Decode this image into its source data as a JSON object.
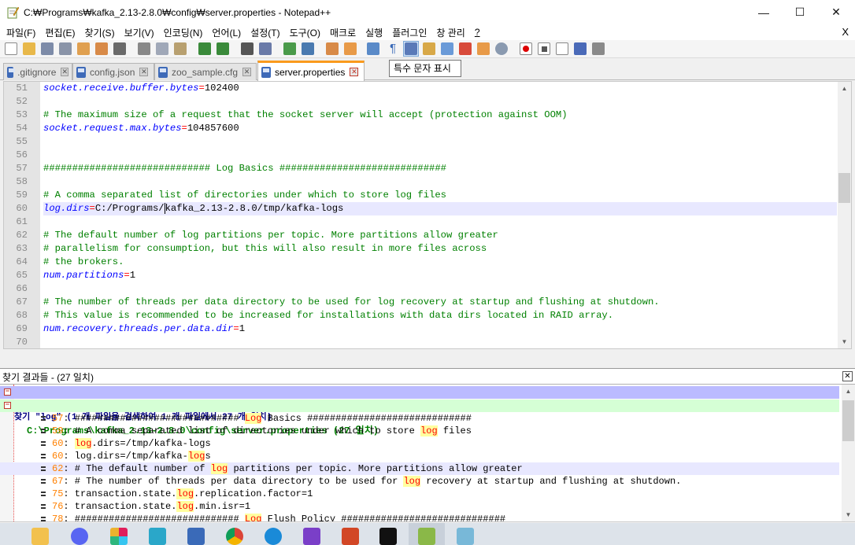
{
  "window": {
    "title": "C:₩Programs₩kafka_2.13-2.8.0₩config₩server.properties - Notepad++",
    "minimize_glyph": "—",
    "maximize_glyph": "☐",
    "close_glyph": "✕"
  },
  "menu": {
    "items": [
      "파일(F)",
      "편집(E)",
      "찾기(S)",
      "보기(V)",
      "인코딩(N)",
      "언어(L)",
      "설정(T)",
      "도구(O)",
      "매크로",
      "실행",
      "플러그인",
      "창 관리",
      "?"
    ],
    "close_label": "X"
  },
  "toolbar": {
    "icons": [
      "new-file-icon",
      "open-icon",
      "save-icon",
      "save-all-icon",
      "close-icon",
      "close-all-icon",
      "print-icon",
      "cut-icon",
      "copy-icon",
      "paste-icon",
      "undo-icon",
      "redo-icon",
      "find-icon",
      "replace-icon",
      "zoom-in-icon",
      "zoom-out-icon",
      "sync-v-icon",
      "sync-h-icon",
      "word-wrap-icon",
      "show-all-chars-icon",
      "indent-guide-icon",
      "doc-map-icon",
      "function-list-icon",
      "folder-workspace-icon",
      "monitor-icon",
      "record-macro-icon",
      "stop-macro-icon",
      "play-macro-icon",
      "run-macro-multiple-icon",
      "save-macro-icon"
    ],
    "tooltip": "특수 문자 표시"
  },
  "tabs": [
    {
      "label": ".gitignore",
      "active": false
    },
    {
      "label": "config.json",
      "active": false
    },
    {
      "label": "zoo_sample.cfg",
      "active": false
    },
    {
      "label": "server.properties",
      "active": true
    }
  ],
  "editor": {
    "lines": [
      {
        "n": "51",
        "type": "kv",
        "key": "socket.receive.buffer.bytes",
        "value": "102400"
      },
      {
        "n": "52",
        "type": "blank"
      },
      {
        "n": "53",
        "type": "comment",
        "text": "# The maximum size of a request that the socket server will accept (protection against OOM)"
      },
      {
        "n": "54",
        "type": "kv",
        "key": "socket.request.max.bytes",
        "value": "104857600"
      },
      {
        "n": "55",
        "type": "blank"
      },
      {
        "n": "56",
        "type": "blank"
      },
      {
        "n": "57",
        "type": "comment",
        "text": "############################# Log Basics #############################"
      },
      {
        "n": "58",
        "type": "blank"
      },
      {
        "n": "59",
        "type": "comment",
        "text": "# A comma separated list of directories under which to store log files"
      },
      {
        "n": "60",
        "type": "kv-caret",
        "key": "log.dirs",
        "value_before": "C:/Programs/",
        "value_after": "kafka_2.13-2.8.0/tmp/kafka-logs"
      },
      {
        "n": "61",
        "type": "blank"
      },
      {
        "n": "62",
        "type": "comment",
        "text": "# The default number of log partitions per topic. More partitions allow greater"
      },
      {
        "n": "63",
        "type": "comment",
        "text": "# parallelism for consumption, but this will also result in more files across"
      },
      {
        "n": "64",
        "type": "comment",
        "text": "# the brokers."
      },
      {
        "n": "65",
        "type": "kv",
        "key": "num.partitions",
        "value": "1"
      },
      {
        "n": "66",
        "type": "blank"
      },
      {
        "n": "67",
        "type": "comment",
        "text": "# The number of threads per data directory to be used for log recovery at startup and flushing at shutdown."
      },
      {
        "n": "68",
        "type": "comment",
        "text": "# This value is recommended to be increased for installations with data dirs located in RAID array."
      },
      {
        "n": "69",
        "type": "kv",
        "key": "num.recovery.threads.per.data.dir",
        "value": "1"
      },
      {
        "n": "70",
        "type": "blank"
      }
    ]
  },
  "find_results": {
    "title": "찾기 결과들 - (27 일치)",
    "close_glyph": "✕",
    "search_line": "찾기 \"log\" (1 개 파일을 검색하여 1 개 파일에서 27 개 일치)",
    "file_line": "C:\\Programs\\kafka_2.13-2.8.0\\config\\server.properties (27 일치)",
    "results": [
      {
        "num": "57",
        "before": "############################# ",
        "match": "Log",
        "after": " Basics #############################"
      },
      {
        "num": "59",
        "before": "# A comma separated list of directories under which to store ",
        "match": "log",
        "after": " files"
      },
      {
        "num": "60",
        "before": "",
        "match": "log",
        "after": ".dirs=/tmp/kafka-logs"
      },
      {
        "num": "60",
        "before": "log.dirs=/tmp/kafka-",
        "match": "log",
        "after": "s"
      },
      {
        "num": "62",
        "before": "# The default number of ",
        "match": "log",
        "after": " partitions per topic. More partitions allow greater"
      },
      {
        "num": "67",
        "before": "# The number of threads per data directory to be used for ",
        "match": "log",
        "after": " recovery at startup and flushing at shutdown."
      },
      {
        "num": "75",
        "before": "transaction.state.",
        "match": "log",
        "after": ".replication.factor=1"
      },
      {
        "num": "76",
        "before": "transaction.state.",
        "match": "log",
        "after": ".min.isr=1"
      },
      {
        "num": "78",
        "before": "############################# ",
        "match": "Log",
        "after": " Flush Policy #############################"
      }
    ]
  },
  "taskbar": {
    "apps": [
      "file-explorer-icon",
      "discord-icon",
      "slack-icon",
      "app-icon",
      "remote-desktop-icon",
      "chrome-icon",
      "download-icon",
      "visual-studio-icon",
      "powerpoint-icon",
      "terminal-icon",
      "notepadpp-icon",
      "app2-icon"
    ]
  }
}
